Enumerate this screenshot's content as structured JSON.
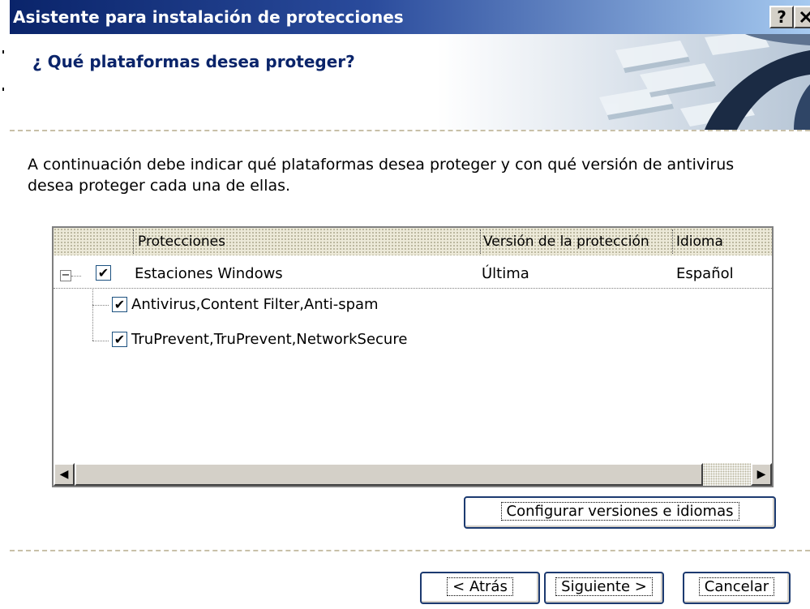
{
  "window": {
    "title": "Asistente para instalación de protecciones",
    "help_label": "?",
    "close_label": "✕"
  },
  "header": {
    "question": "¿ Qué plataformas desea proteger?"
  },
  "intro_text": "A continuación debe indicar qué plataformas desea proteger y con qué versión de antivirus desea proteger cada una de ellas.",
  "list": {
    "columns": [
      "Protecciones",
      "Versión de la protección",
      "Idioma"
    ],
    "rows": [
      {
        "label": "Estaciones Windows",
        "version": "Última",
        "language": "Español",
        "checked": true,
        "expanded": true,
        "expander": "−",
        "check": "✔"
      },
      {
        "label": "Antivirus,Content Filter,Anti-spam",
        "checked": true,
        "check": "✔"
      },
      {
        "label": "TruPrevent,TruPrevent,NetworkSecure",
        "checked": true,
        "check": "✔"
      }
    ],
    "scroll_left": "◀",
    "scroll_right": "▶"
  },
  "buttons": {
    "configure": "Configurar versiones e idiomas",
    "back": "< Atrás",
    "next": "Siguiente >",
    "cancel": "Cancelar"
  },
  "colors": {
    "title_bar": "#0a246a",
    "question_text": "#0a246a",
    "button_border": "#1c3a70"
  }
}
